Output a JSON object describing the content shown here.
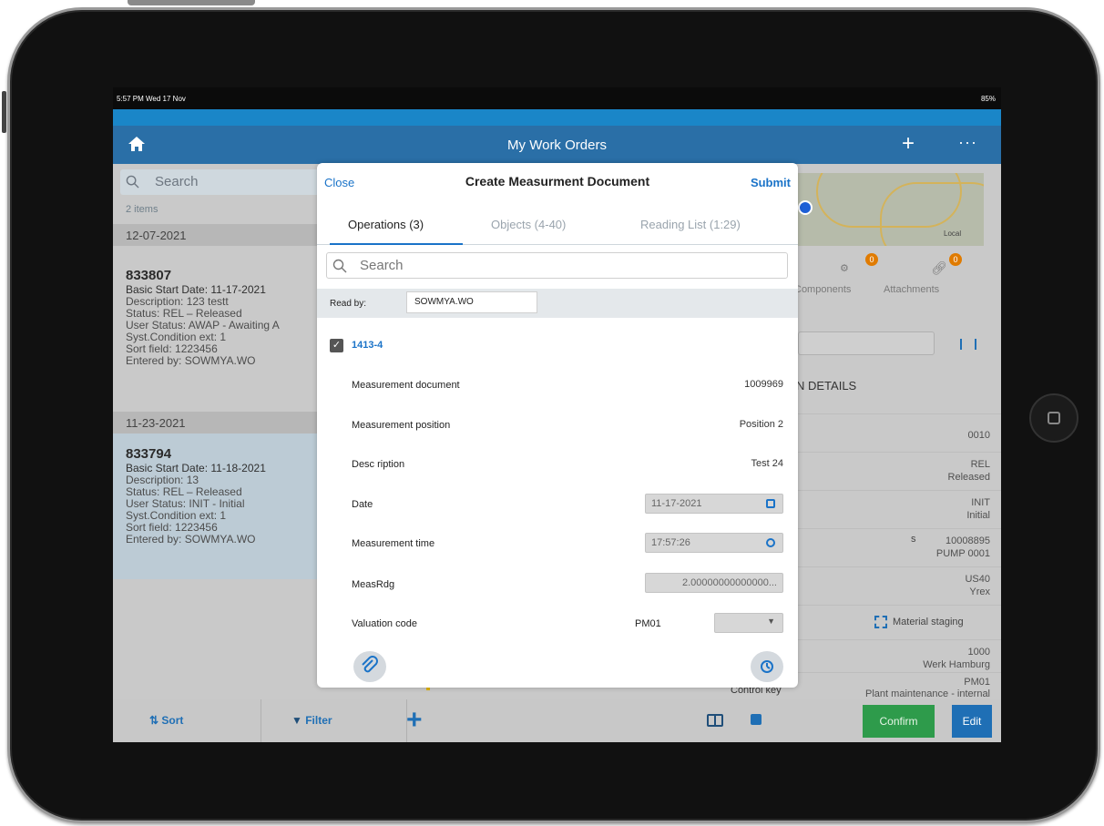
{
  "status_bar": {
    "time": "5:57 PM  Wed 17 Nov",
    "right": "85%"
  },
  "app": {
    "title": "My Work Orders"
  },
  "list": {
    "search_placeholder": "Search",
    "count": "2 items",
    "groups": [
      {
        "date": "12-07-2021",
        "item": {
          "number": "833807",
          "lines": [
            "Basic Start Date: 11-17-2021",
            "Description: 123 testt",
            "Status: REL – Released",
            "User Status: AWAP - Awaiting A",
            "Syst.Condition ext: 1",
            "Sort field: 1223456",
            "Entered by: SOWMYA.WO"
          ]
        }
      },
      {
        "date": "11-23-2021",
        "item": {
          "number": "833794",
          "lines": [
            "Basic Start Date: 11-18-2021",
            "Description: 13",
            "Status: REL – Released",
            "User Status: INIT - Initial",
            "Syst.Condition ext: 1",
            "Sort field: 1223456",
            "Entered by: SOWMYA.WO"
          ]
        }
      }
    ],
    "sort_label": "Sort",
    "filter_label": "Filter"
  },
  "detail": {
    "map_label": "Local",
    "tabs": [
      {
        "label": "Components",
        "badge": "0"
      },
      {
        "label": "Attachments",
        "badge": "0"
      }
    ],
    "section_title": "N DETAILS",
    "rows": [
      {
        "top": "0010",
        "bottom": ""
      },
      {
        "left": "s",
        "top": "REL",
        "bottom": "Released"
      },
      {
        "top": "INIT",
        "bottom": "Initial"
      },
      {
        "top": "10008895",
        "bottom": "PUMP 0001"
      },
      {
        "top": "US40",
        "bottom": "Yrex"
      }
    ],
    "staging": "Material staging",
    "plant_top": "1000",
    "plant_bottom": "Werk Hamburg",
    "control_label": "Control key",
    "control_top": "PM01",
    "control_bottom": "Plant maintenance - internal",
    "confirm": "Confirm",
    "edit": "Edit"
  },
  "modal": {
    "close": "Close",
    "title": "Create Measurment Document",
    "submit": "Submit",
    "tabs": [
      "Operations (3)",
      "Objects (4-40)",
      "Reading List (1:29)"
    ],
    "search_placeholder": "Search",
    "read_by_label": "Read by:",
    "read_by_value": "SOWMYA.WO",
    "operation": "1413-4",
    "fields": {
      "measurement_document_label": "Measurement document",
      "measurement_document_value": "1009969",
      "measurement_position_label": "Measurement position",
      "measurement_position_value": "Position 2",
      "description_label": "Desc ription",
      "description_value": "Test 24",
      "date_label": "Date",
      "date_value": "11-17-2021",
      "time_label": "Measurement time",
      "time_value": "17:57:26",
      "measrdg_label": "MeasRdg",
      "measrdg_value": "2.00000000000000...",
      "valuation_label": "Valuation code",
      "valuation_value": "PM01"
    }
  },
  "colors": {
    "header": "#2a6fa7",
    "accent": "#1a73c8",
    "confirm": "#2e9b4b"
  }
}
